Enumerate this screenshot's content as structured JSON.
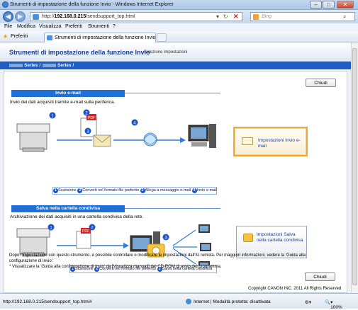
{
  "window": {
    "title": "Strumenti di impostazione della funzione Invio - Windows Internet Explorer"
  },
  "address": {
    "prefix": "http://",
    "host": "192.168.0.215",
    "path": "/sendsupport_top.html"
  },
  "search": {
    "placeholder": "Bing"
  },
  "menu": [
    "File",
    "Modifica",
    "Visualizza",
    "Preferiti",
    "Strumenti",
    "?"
  ],
  "favorites": {
    "label": "Preferiti",
    "tab": "Strumenti di impostazione della funzione Invio"
  },
  "page": {
    "title": "Strumenti di impostazione della funzione Invio",
    "subtitle": "Selezione impostazioni",
    "breadcrumb_a": "Series /",
    "breadcrumb_b": "Series /",
    "close_label": "Chiudi"
  },
  "email": {
    "section": "Invio e-mail",
    "description": "Invio dei dati acquisiti tramite e-mail sulla periferica.",
    "steps": [
      "Scansione",
      "Converti nel formato file preferito",
      "Allega a messaggio e-mail",
      "Invio e-mail"
    ],
    "button": "Impostazioni Invio e-mail"
  },
  "folder": {
    "section": "Salva nella cartella condivisa",
    "description": "Archiviazione dei dati acquisiti in una cartella condivisa della rete.",
    "steps": [
      "Scansione",
      "Converti nel formato file preferito",
      "Salva nella cartella condivisa"
    ],
    "button": "Impostazioni Salva nella cartella condivisa"
  },
  "footer": {
    "note1": "Dopo l'impostazione con questo strumento, è possibile controllare o modificare le impostazioni dall'IU remota. Per maggiori informazioni, vedere la 'Guida alla",
    "note2": "configurazione di Invio'.",
    "note3": "* Visualizzare la 'Guida alla configurazione di Invio' da [Visualizza manuali] del CD-ROM di avvio del programma.",
    "close_label": "Chiudi",
    "copyright": "Copyright CANON INC. 2011 All Rights Reserved"
  },
  "status": {
    "url": "http://192.168.0.215/sendsupport_top.html#",
    "zone": "Internet | Modalità protetta: disattivata",
    "zoom": "100%"
  },
  "colors": {
    "accent": "#1f6fd6",
    "title": "#1d3f8f",
    "highlight": "#f0a83a"
  }
}
